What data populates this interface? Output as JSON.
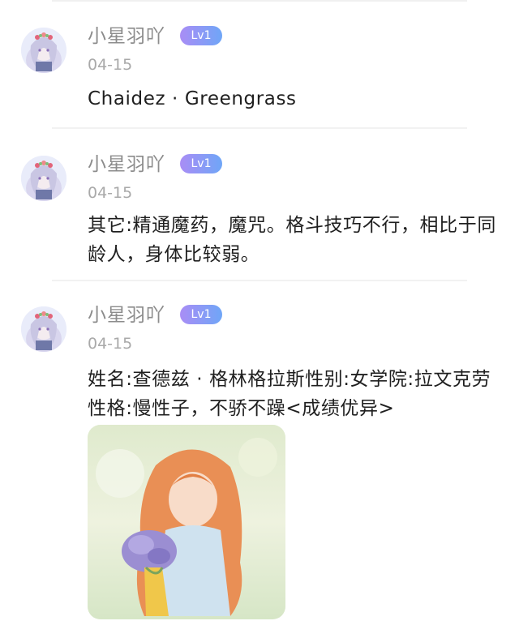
{
  "posts": [
    {
      "username": "小星羽吖",
      "level": "Lv1",
      "date": "04-15",
      "content": "Chaidez · Greengrass"
    },
    {
      "username": "小星羽吖",
      "level": "Lv1",
      "date": "04-15",
      "content": "其它:精通魔药，魔咒。格斗技巧不行，相比于同龄人，身体比较弱。"
    },
    {
      "username": "小星羽吖",
      "level": "Lv1",
      "date": "04-15",
      "content": "姓名:查德兹 · 格林格拉斯性别:女学院:拉文克劳性格:慢性子，不骄不躁<成绩优异>"
    }
  ],
  "colors": {
    "username": "#8c8c8c",
    "date": "#a9a9a9",
    "badge_from": "#a98df5",
    "badge_to": "#6fa6f7"
  }
}
